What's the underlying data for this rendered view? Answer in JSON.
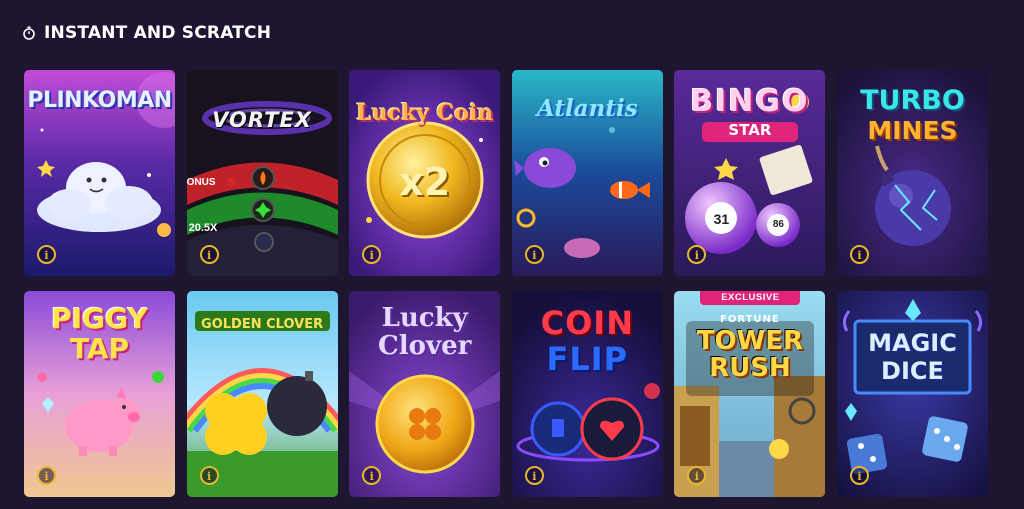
{
  "section": {
    "title": "INSTANT AND SCRATCH",
    "icon": "stopwatch-icon"
  },
  "info_glyph": "i",
  "games": [
    {
      "id": "plinkoman",
      "lines": [
        "PLINKOMAN"
      ]
    },
    {
      "id": "vortex",
      "lines": [
        "VORTEX"
      ],
      "labels": [
        "ONUS",
        "20.5X"
      ]
    },
    {
      "id": "lucky-coin",
      "lines": [
        "Lucky Coin"
      ],
      "coin_text": "x2"
    },
    {
      "id": "atlantis",
      "lines": [
        "Atlantis"
      ]
    },
    {
      "id": "bingo-star",
      "lines": [
        "BINGO",
        "STAR"
      ],
      "balls": [
        "31",
        "86"
      ]
    },
    {
      "id": "turbo-mines",
      "lines": [
        "TURBO",
        "MINES"
      ]
    },
    {
      "id": "piggy-tap",
      "lines": [
        "PIGGY",
        "TAP"
      ]
    },
    {
      "id": "golden-clover",
      "lines": [
        "GOLDEN CLOVER"
      ]
    },
    {
      "id": "lucky-clover",
      "lines": [
        "Lucky",
        "Clover"
      ]
    },
    {
      "id": "coin-flip",
      "lines": [
        "COIN",
        "FLIP"
      ]
    },
    {
      "id": "fortune-tower-rush",
      "badge": "EXCLUSIVE",
      "lines": [
        "FORTUNE",
        "TOWER",
        "RUSH"
      ]
    },
    {
      "id": "magic-dice",
      "lines": [
        "MAGIC",
        "DICE"
      ]
    }
  ],
  "colors": {
    "background": "#1e1530",
    "info_accent": "#e8b82a",
    "badge": "#e0237b"
  }
}
